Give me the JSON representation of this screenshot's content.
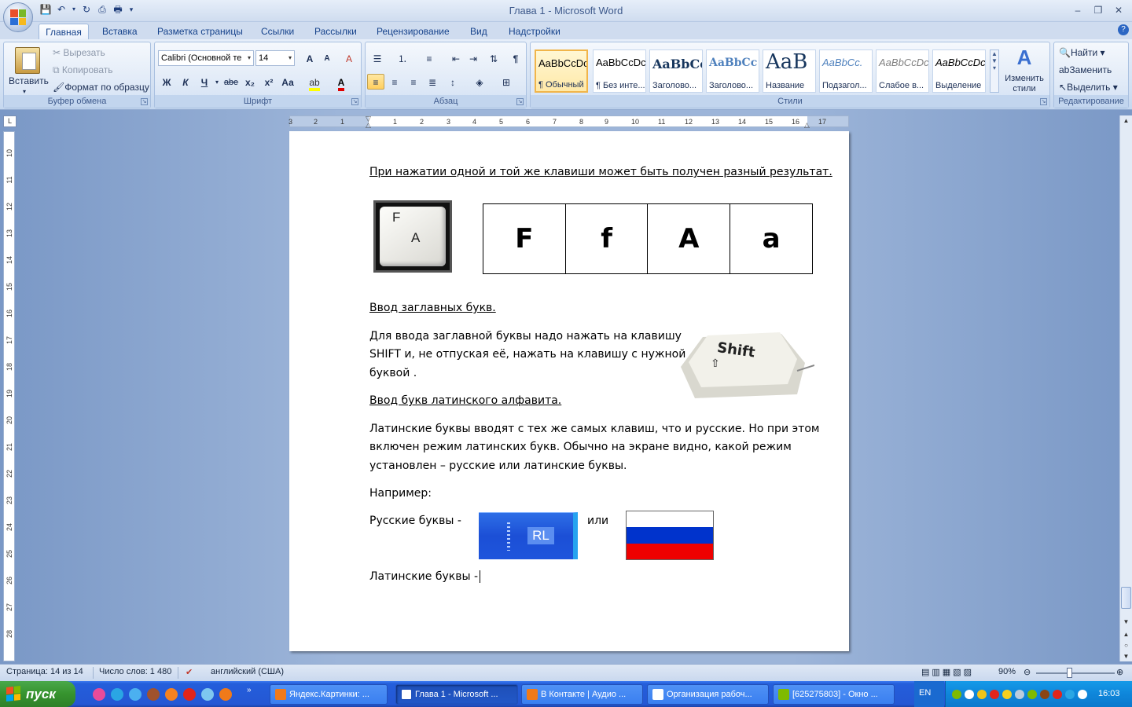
{
  "window": {
    "title": "Глава 1 - Microsoft Word"
  },
  "tabs": [
    "Главная",
    "Вставка",
    "Разметка страницы",
    "Ссылки",
    "Рассылки",
    "Рецензирование",
    "Вид",
    "Надстройки"
  ],
  "clipboard": {
    "paste": "Вставить",
    "cut": "Вырезать",
    "copy": "Копировать",
    "format_painter": "Формат по образцу",
    "label": "Буфер обмена"
  },
  "font": {
    "name": "Calibri (Основной те",
    "size": "14",
    "label": "Шрифт",
    "bold": "Ж",
    "italic": "К",
    "underline": "Ч",
    "strike": "abe",
    "sub": "x₂",
    "sup": "x²",
    "case": "Аа",
    "grow": "A",
    "shrink": "A",
    "clear": "A"
  },
  "paragraph": {
    "label": "Абзац"
  },
  "styles": {
    "label": "Стили",
    "items": [
      {
        "preview": "AaBbCcDc",
        "name": "¶ Обычный"
      },
      {
        "preview": "AaBbCcDc",
        "name": "¶ Без инте..."
      },
      {
        "preview": "AaBbCc",
        "name": "Заголово..."
      },
      {
        "preview": "AaBbCc",
        "name": "Заголово..."
      },
      {
        "preview": "AaB",
        "name": "Название"
      },
      {
        "preview": "AaBbCc.",
        "name": "Подзагол..."
      },
      {
        "preview": "AaBbCcDc",
        "name": "Слабое в..."
      },
      {
        "preview": "AaBbCcDc",
        "name": "Выделение"
      }
    ],
    "change": "Изменить стили"
  },
  "editing": {
    "label": "Редактирование",
    "find": "Найти",
    "replace": "Заменить",
    "select": "Выделить"
  },
  "ruler": {
    "h_numbers": [
      "3",
      "2",
      "1",
      "1",
      "2",
      "3",
      "4",
      "5",
      "6",
      "7",
      "8",
      "9",
      "10",
      "11",
      "12",
      "13",
      "14",
      "15",
      "16",
      "17"
    ],
    "v_numbers": [
      "10",
      "11",
      "12",
      "13",
      "14",
      "15",
      "16",
      "17",
      "18",
      "19",
      "20",
      "21",
      "22",
      "23",
      "24",
      "25",
      "26",
      "27",
      "28"
    ]
  },
  "document": {
    "line1": "При нажатии одной и той же клавиши может быть получен разный результат.",
    "key_letters": [
      "F",
      "A"
    ],
    "table_letters": [
      "F",
      "f",
      "A",
      "a"
    ],
    "heading_caps": "Ввод заглавных букв.",
    "caps_text_1": "Для ввода заглавной буквы надо нажать на клавишу",
    "caps_text_2": "SHIFT и, не отпуская её, нажать на клавишу с нужной",
    "caps_text_3": "буквой .",
    "shift_label": "Shift",
    "heading_latin": "Ввод букв латинского алфавита.",
    "latin_text_1": "Латинские буквы вводят с тех же самых клавиш, что и русские. Но при этом",
    "latin_text_2": "включен режим латинских букв. Обычно на экране видно, какой режим",
    "latin_text_3": "установлен – русские или латинские буквы.",
    "example": "Например:",
    "russian": "Русские буквы -",
    "or": "или",
    "rl_label": "RL",
    "latin": "Латинские буквы -"
  },
  "status": {
    "page": "Страница: 14 из 14",
    "words": "Число слов: 1 480",
    "lang": "английский (США)",
    "zoom": "90%"
  },
  "taskbar": {
    "start": "пуск",
    "items": [
      {
        "label": "Яндекс.Картинки: ...",
        "active": false
      },
      {
        "label": "Глава 1 - Microsoft ...",
        "active": true
      },
      {
        "label": "В Контакте | Аудио ...",
        "active": false
      },
      {
        "label": "Организация рабоч...",
        "active": false
      },
      {
        "label": "[625275803] - Окно ...",
        "active": false
      }
    ],
    "lang": "EN",
    "time": "16:03"
  },
  "colors": {
    "flag_white": "#ffffff",
    "flag_blue": "#0033cc",
    "flag_red": "#ee0000",
    "accent": "#15428b"
  }
}
